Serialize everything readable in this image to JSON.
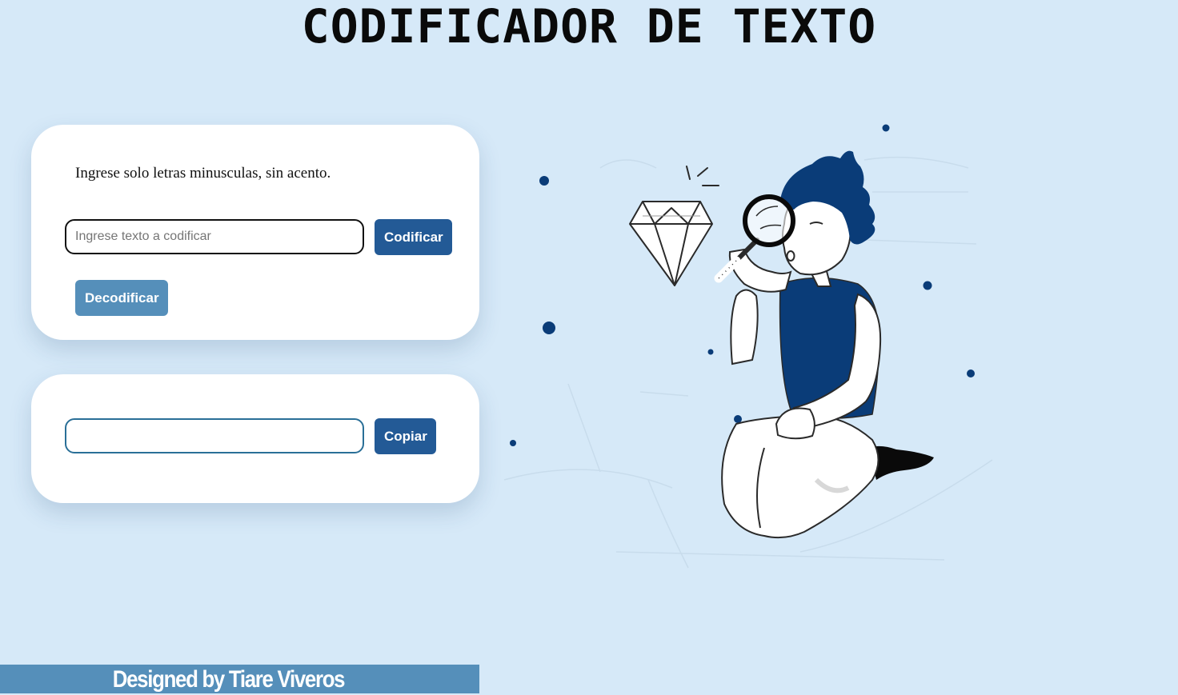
{
  "header": {
    "title": "CODIFICADOR DE TEXTO"
  },
  "encoder": {
    "instruction": "Ingrese solo letras minusculas, sin acento.",
    "input_value": "",
    "input_placeholder": "Ingrese texto a codificar",
    "encode_label": "Codificar",
    "decode_label": "Decodificar"
  },
  "output": {
    "value": "",
    "copy_label": "Copiar"
  },
  "footer": {
    "credit": "Designed by Tiare Viveros"
  },
  "illustration": {
    "icon": "person-magnifying-diamond-illustration"
  },
  "colors": {
    "background": "#d6e9f8",
    "card": "#ffffff",
    "primary_button": "#235a96",
    "secondary_button": "#558fba",
    "footer": "#558fba",
    "illustration_accent": "#0a3c78"
  }
}
